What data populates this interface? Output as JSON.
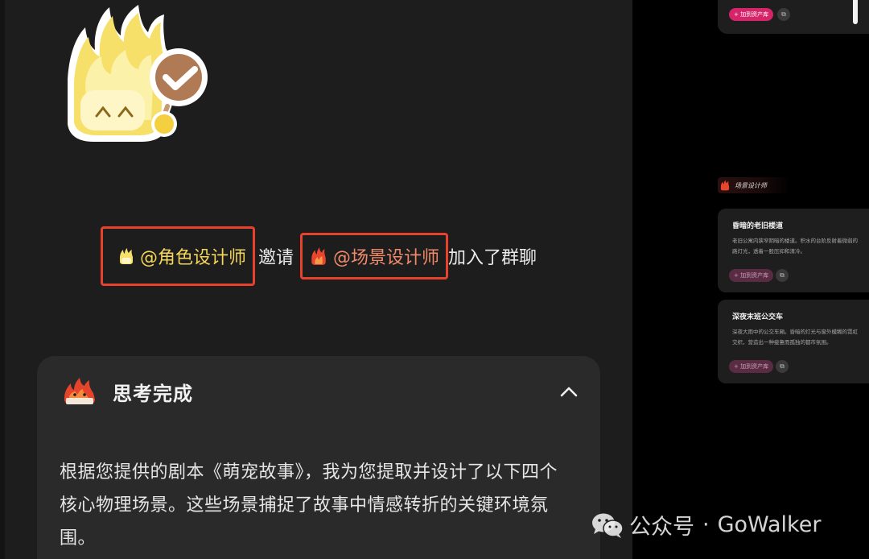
{
  "chat": {
    "system_message": {
      "inviter": "@角色设计师",
      "verb": "邀请",
      "invitee": "@场景设计师",
      "suffix": "加入了群聊"
    },
    "thinking": {
      "title": "思考完成",
      "body": "根据您提供的剧本《萌宠故事》，我为您提取并设计了以下四个核心物理场景。这些场景捕捉了故事中情感转折的关键环境氛围。"
    }
  },
  "right_panel": {
    "top_card": {
      "add_button": "+ 加到资产库"
    },
    "section_label": "场景设计师",
    "scenes": [
      {
        "title": "昏暗的老旧楼道",
        "description": "老旧公寓内狭窄阴暗的楼道。积水的台阶反射着微弱的路灯光，透着一股压抑和清冷。",
        "add_button": "+ 加到资产库"
      },
      {
        "title": "深夜末班公交车",
        "description": "深夜大雨中的公交车厢。昏暗的灯光与窗外模糊的霓虹交织，营造出一种疲惫而孤独的都市氛围。",
        "add_button": "+ 加到资产库"
      }
    ]
  },
  "watermark": {
    "prefix": "公众号",
    "separator": "·",
    "name": "GoWalker"
  },
  "colors": {
    "accent_red": "#e8412e",
    "role_yellow": "#f4d65a",
    "scene_orange": "#f08a6a",
    "pink": "#d6246a"
  }
}
